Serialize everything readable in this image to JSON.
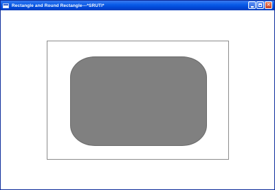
{
  "window": {
    "title": "Rectangle and Round Rectangle---*SRUTI*",
    "controls": [
      "minimize",
      "maximize",
      "close"
    ],
    "titlebar_color": "#0a5ce8"
  },
  "canvas": {
    "background": "#ffffff",
    "shapes": [
      {
        "type": "rectangle",
        "fill": "#ffffff",
        "stroke": "#8a8a8a"
      },
      {
        "type": "round-rectangle",
        "fill": "#808080",
        "stroke": "#6a6a6a"
      }
    ]
  }
}
